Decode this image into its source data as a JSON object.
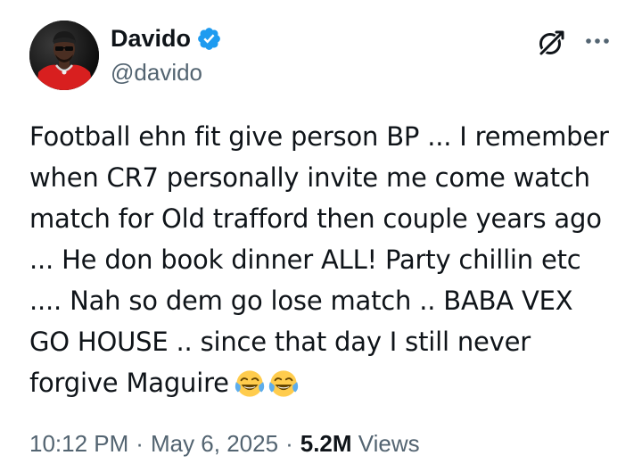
{
  "user": {
    "display_name": "Davido",
    "handle": "@davido",
    "verified": true,
    "verified_color": "#1d9bf0"
  },
  "tweet": {
    "lines": [
      "Football ehn fit give person BP ... I remember",
      "when CR7 personally invite me come watch",
      "match for Old trafford then couple years ago",
      "... He don book dinner ALL! Party chillin etc",
      ".... Nah so dem go lose match .. BABA VEX",
      "GO HOUSE .. since that day I still never",
      "forgive Maguire"
    ],
    "emojis": [
      "face-with-tears-of-joy",
      "face-with-tears-of-joy"
    ]
  },
  "meta": {
    "time": "10:12 PM",
    "separator": "·",
    "date": "May 6, 2025",
    "views_count": "5.2M",
    "views_label": "Views"
  },
  "icons": {
    "grok": "grok-icon",
    "more": "more-icon",
    "verified": "verified-badge-icon"
  },
  "colors": {
    "text": "#0f1419",
    "secondary": "#536471",
    "accent": "#1d9bf0",
    "avatar_bg": "#d81f1f"
  }
}
